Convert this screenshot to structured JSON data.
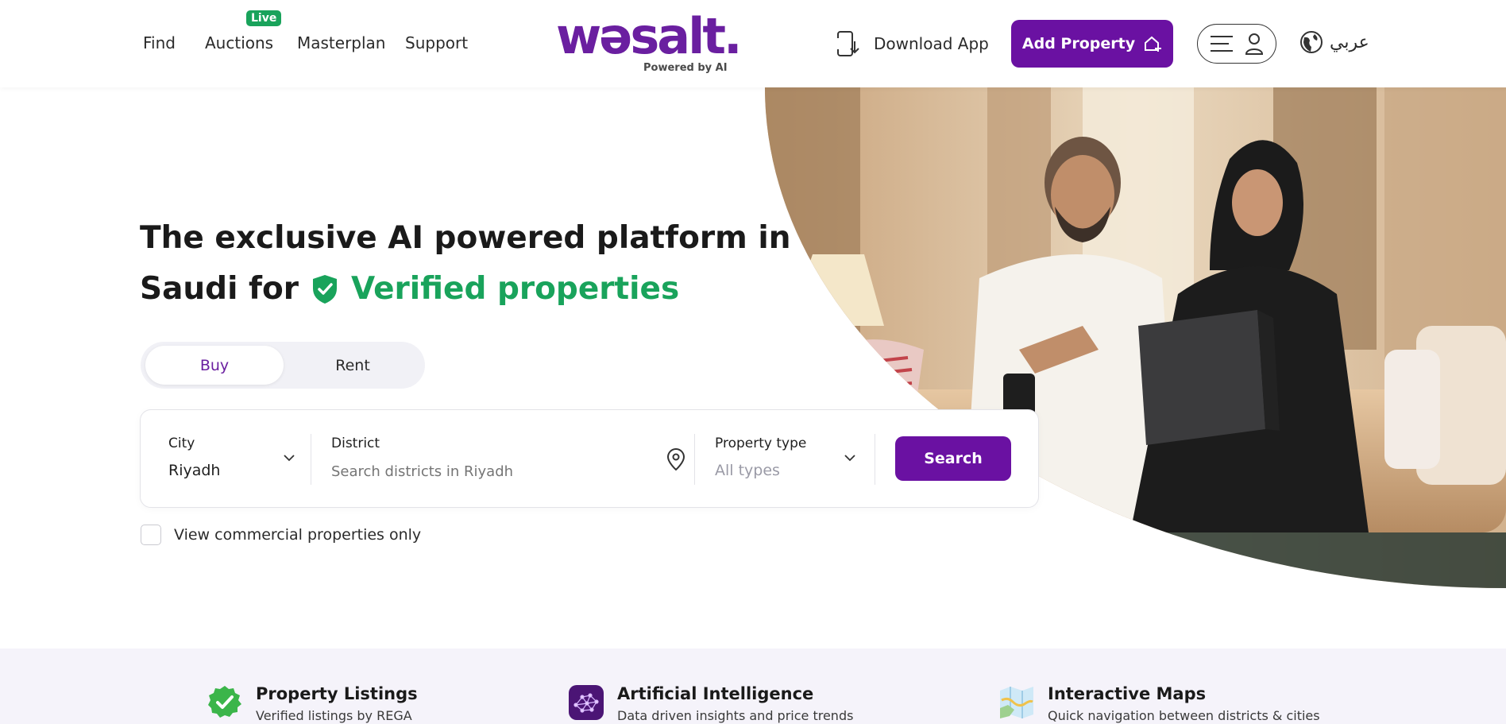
{
  "header": {
    "nav": [
      "Find",
      "Auctions",
      "Masterplan",
      "Support"
    ],
    "live_badge": "Live",
    "logo_text": "wəsalt.",
    "logo_sub": "Powered by AI",
    "download_label": "Download App",
    "add_property_label": "Add Property",
    "language_label": "عربي"
  },
  "hero": {
    "headline_line1": "The exclusive AI powered platform in",
    "headline_line2_prefix": "Saudi for",
    "headline_highlight": "Verified properties",
    "tabs": [
      "Buy",
      "Rent"
    ],
    "active_tab": "Buy"
  },
  "search": {
    "city_label": "City",
    "city_value": "Riyadh",
    "district_label": "District",
    "district_placeholder": "Search districts in Riyadh",
    "type_label": "Property type",
    "type_value": "All types",
    "button_label": "Search",
    "commercial_label": "View commercial properties only",
    "commercial_checked": false
  },
  "features": [
    {
      "title": "Property Listings",
      "desc": "Verified listings by REGA",
      "icon": "verified-check-icon"
    },
    {
      "title": "Artificial Intelligence",
      "desc": "Data driven insights and price trends",
      "icon": "ai-network-icon"
    },
    {
      "title": "Interactive Maps",
      "desc": "Quick navigation between districts & cities",
      "icon": "map-icon"
    }
  ],
  "colors": {
    "brand_purple": "#6a11a2",
    "verified_green": "#19a35b",
    "feature_band": "#f5f3fa"
  }
}
